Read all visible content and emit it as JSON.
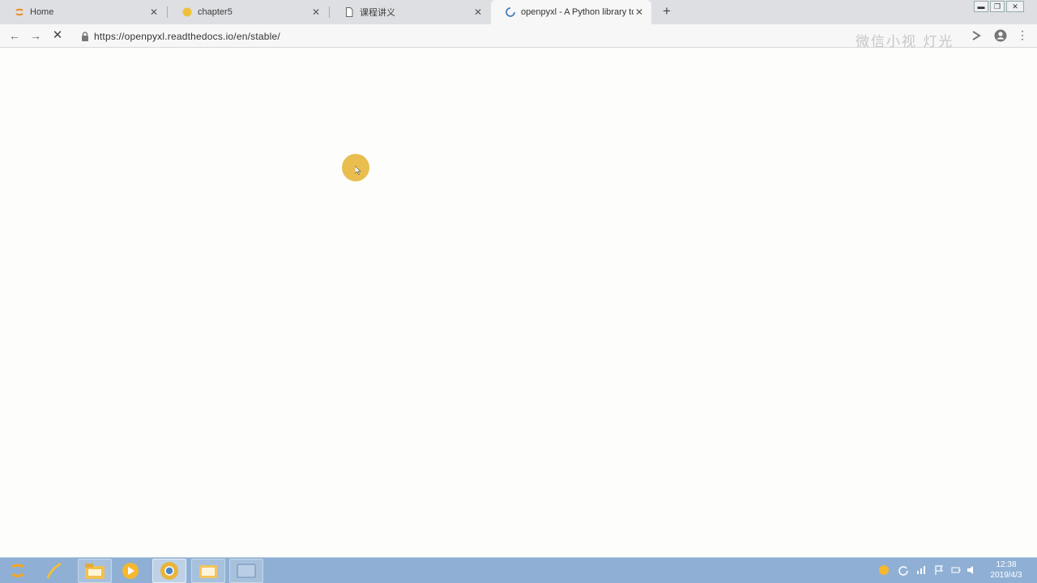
{
  "browser": {
    "tabs": [
      {
        "title": "Home",
        "favicon": "jupyter-icon",
        "active": false
      },
      {
        "title": "chapter5",
        "favicon": "python-icon",
        "active": false
      },
      {
        "title": "课程讲义",
        "favicon": "document-icon",
        "active": false
      },
      {
        "title": "openpyxl - A Python library to",
        "favicon": "loading-spinner-icon",
        "active": true
      }
    ],
    "close_glyph": "✕",
    "new_tab_glyph": "+",
    "url": "https://openpyxl.readthedocs.io/en/stable/",
    "watermark": "微信小视 灯光",
    "nav": {
      "back": "←",
      "forward": "→",
      "stop": "✕"
    },
    "menu_glyph": "⋮"
  },
  "taskbar": {
    "apps": [
      "start-icon",
      "pen-app-icon",
      "file-explorer-icon",
      "media-player-icon",
      "chrome-icon",
      "folder-icon",
      "window-icon"
    ],
    "clock": {
      "time": "12:38",
      "date": "2019/4/3"
    }
  },
  "colors": {
    "cursor_highlight": "#e8ba46",
    "taskbar": "#8fb0d4",
    "tabstrip": "#dedfe3"
  }
}
